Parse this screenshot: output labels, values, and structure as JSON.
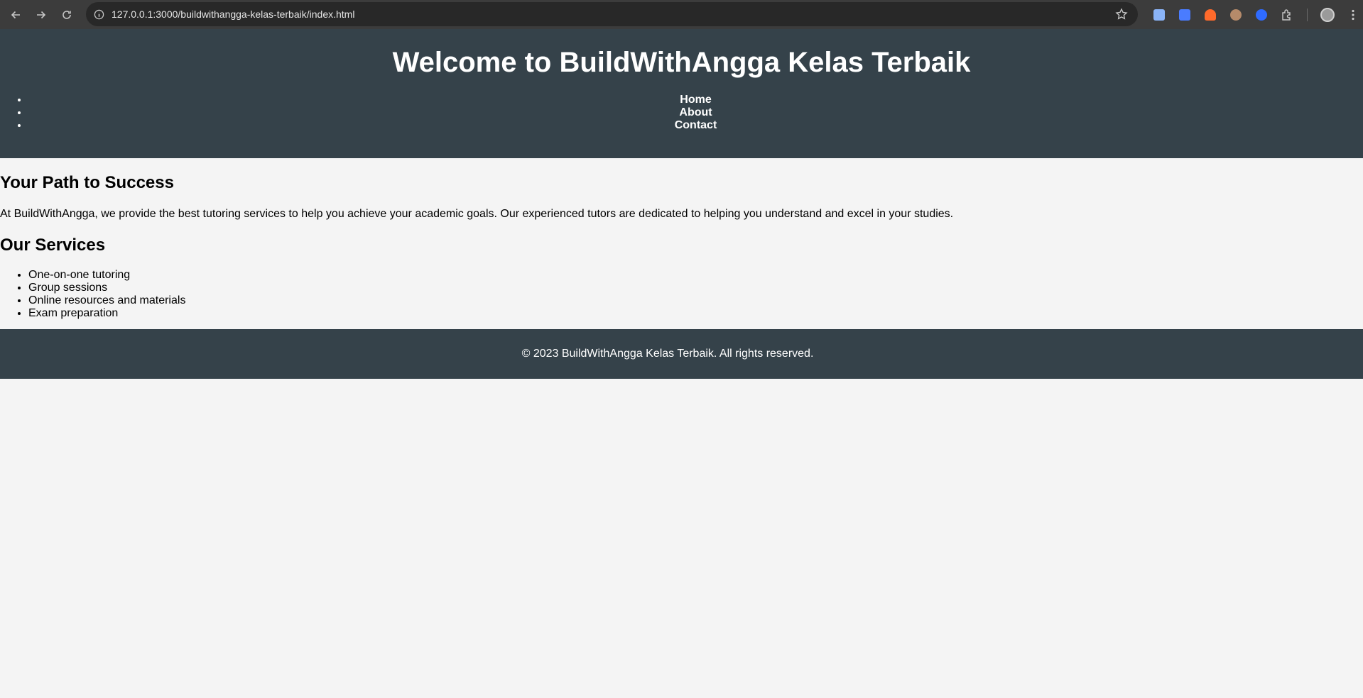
{
  "browser": {
    "url": "127.0.0.1:3000/buildwithangga-kelas-terbaik/index.html",
    "extensions": [
      {
        "name": "docs-extension",
        "color": "#8ab4f8"
      },
      {
        "name": "translate-extension",
        "color": "#4a7cff"
      },
      {
        "name": "fox-extension",
        "color": "#ff6a2b"
      },
      {
        "name": "eyes-extension",
        "color": "#b58a6a"
      },
      {
        "name": "chat-extension",
        "color": "#2f6bff"
      }
    ]
  },
  "header": {
    "title": "Welcome to BuildWithAngga Kelas Terbaik",
    "nav": [
      {
        "label": "Home"
      },
      {
        "label": "About"
      },
      {
        "label": "Contact"
      }
    ]
  },
  "main": {
    "heading1": "Your Path to Success",
    "intro": "At BuildWithAngga, we provide the best tutoring services to help you achieve your academic goals. Our experienced tutors are dedicated to helping you understand and excel in your studies.",
    "heading2": "Our Services",
    "services": [
      "One-on-one tutoring",
      "Group sessions",
      "Online resources and materials",
      "Exam preparation"
    ]
  },
  "footer": {
    "text": "© 2023 BuildWithAngga Kelas Terbaik. All rights reserved."
  },
  "colors": {
    "header_bg": "#35424a",
    "page_bg": "#f4f4f4",
    "browser_bg": "#3c3c3c"
  }
}
